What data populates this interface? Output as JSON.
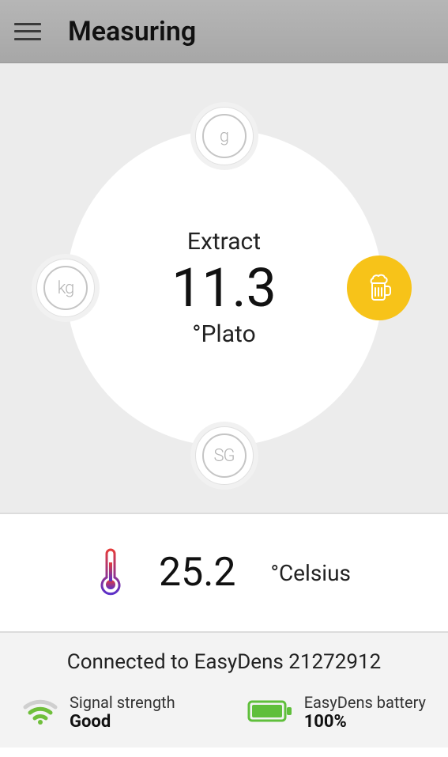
{
  "header": {
    "title": "Measuring"
  },
  "dial": {
    "label": "Extract",
    "value": "11.3",
    "unit": "°Plato",
    "orbits": {
      "g": {
        "glyph": "g",
        "name": "grams-mode"
      },
      "kg": {
        "glyph": "kg",
        "name": "kilograms-mode"
      },
      "sg": {
        "glyph": "SG",
        "name": "specific-gravity-mode"
      },
      "beer": {
        "glyph": "beer",
        "name": "extract-plato-mode",
        "active": true
      }
    }
  },
  "temperature": {
    "value": "25.2",
    "unit": "°Celsius"
  },
  "status": {
    "connected_line": "Connected to EasyDens 21272912",
    "signal": {
      "label": "Signal strength",
      "value": "Good"
    },
    "battery": {
      "label": "EasyDens battery",
      "value": "100%"
    }
  }
}
